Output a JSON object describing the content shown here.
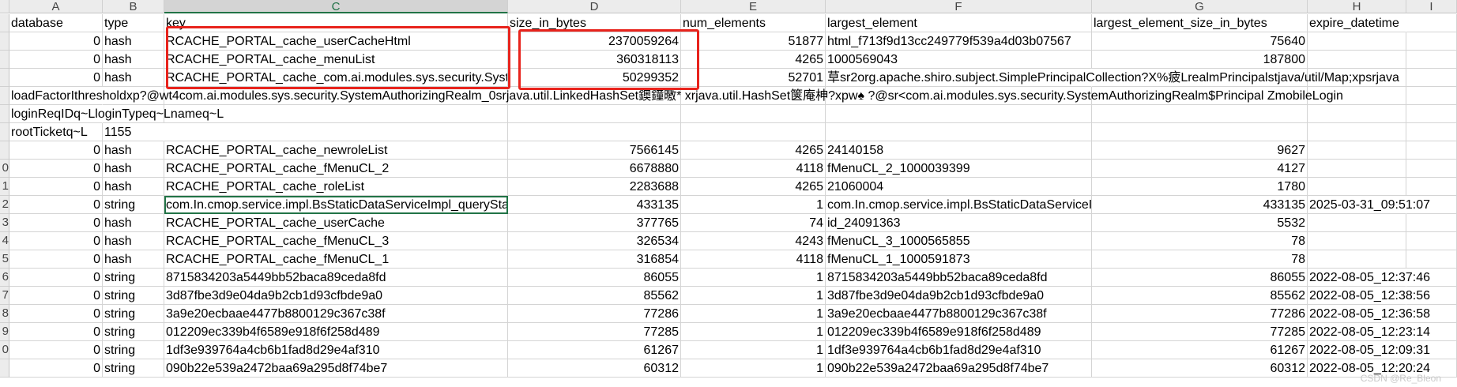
{
  "columns": [
    "A",
    "B",
    "C",
    "D",
    "E",
    "F",
    "G",
    "H",
    "I"
  ],
  "selected_column": "C",
  "row_numbers": [
    "",
    "",
    "",
    "",
    "",
    "",
    "",
    "",
    "0",
    "1",
    "2",
    "3",
    "4",
    "5",
    "6",
    "7",
    "8",
    "9",
    "0",
    ""
  ],
  "rows": [
    [
      "database",
      "type",
      "key",
      "size_in_bytes",
      "num_elements",
      "largest_element",
      "largest_element_size_in_bytes",
      "expire_datetime",
      ""
    ],
    [
      "0",
      "hash",
      "RCACHE_PORTAL_cache_userCacheHtml",
      "2370059264",
      "51877",
      "html_f713f9d13cc249779f539a4d03b07567",
      "75640",
      "",
      ""
    ],
    [
      "0",
      "hash",
      "RCACHE_PORTAL_cache_menuList",
      "360318113",
      "4265",
      "1000569043",
      "187800",
      "",
      ""
    ],
    [
      "0",
      "hash",
      "RCACHE_PORTAL_cache_com.ai.modules.sys.security.SystemAuthorizingRealm",
      "50299352",
      "52701",
      "草\u0001sr2org.apache.shiro.subject.SimplePrincipalCollection?X%疲\u0001\u0001L\u0001realmPrincipals\u0001t\u0001java/util/Map;xpsr\u0001java",
      "",
      "",
      ""
    ],
    [
      "loadFactorIthresholdxp?@\u0001w\u0001\u0001t4com.ai.modules.sys.security.SystemAuthorizingRealm_0sr\u0001java.util.LinkedHashSet鐭鐘曒* xr\u0001java.util.HashSet箧庵柛?\u0001xpw♠ ?@\u0001sr<com.ai.modules.sys.security.SystemAuthorizingRealm$Principal\u0001 \u0001Z\u0001mobileLogin",
      "",
      "",
      "",
      "",
      "",
      "",
      "",
      ""
    ],
    [
      "loginReqIDq~\u0001LloginTypeq~\u0001L\u0001nameq~\u0001L",
      "",
      "",
      "",
      "",
      "",
      "",
      "",
      ""
    ],
    [
      "rootTicketq~\u0001L\u0001",
      "1155",
      "",
      "",
      "",
      "",
      "",
      "",
      ""
    ],
    [
      "0",
      "hash",
      "RCACHE_PORTAL_cache_newroleList",
      "7566145",
      "4265",
      "24140158",
      "9627",
      "",
      ""
    ],
    [
      "0",
      "hash",
      "RCACHE_PORTAL_cache_fMenuCL_2",
      "6678880",
      "4118",
      "fMenuCL_2_1000039399",
      "4127",
      "",
      ""
    ],
    [
      "0",
      "hash",
      "RCACHE_PORTAL_cache_roleList",
      "2283688",
      "4265",
      "21060004",
      "1780",
      "",
      ""
    ],
    [
      "0",
      "string",
      "com.In.cmop.service.impl.BsStaticDataServiceImpl_queryStaticDataList",
      "433135",
      "1",
      "com.In.cmop.service.impl.BsStaticDataServiceImpl",
      "433135",
      "2025-03-31_09:51:07",
      ""
    ],
    [
      "0",
      "hash",
      "RCACHE_PORTAL_cache_userCache",
      "377765",
      "74",
      "id_24091363",
      "5532",
      "",
      ""
    ],
    [
      "0",
      "hash",
      "RCACHE_PORTAL_cache_fMenuCL_3",
      "326534",
      "4243",
      "fMenuCL_3_1000565855",
      "78",
      "",
      ""
    ],
    [
      "0",
      "hash",
      "RCACHE_PORTAL_cache_fMenuCL_1",
      "316854",
      "4118",
      "fMenuCL_1_1000591873",
      "78",
      "",
      ""
    ],
    [
      "0",
      "string",
      "8715834203a5449bb52baca89ceda8fd",
      "86055",
      "1",
      "8715834203a5449bb52baca89ceda8fd",
      "86055",
      "2022-08-05_12:37:46",
      ""
    ],
    [
      "0",
      "string",
      "3d87fbe3d9e04da9b2cb1d93cfbde9a0",
      "85562",
      "1",
      "3d87fbe3d9e04da9b2cb1d93cfbde9a0",
      "85562",
      "2022-08-05_12:38:56",
      ""
    ],
    [
      "0",
      "string",
      "3a9e20ecbaae4477b8800129c367c38f",
      "77286",
      "1",
      "3a9e20ecbaae4477b8800129c367c38f",
      "77286",
      "2022-08-05_12:36:58",
      ""
    ],
    [
      "0",
      "string",
      "012209ec339b4f6589e918f6f258d489",
      "77285",
      "1",
      "012209ec339b4f6589e918f6f258d489",
      "77285",
      "2022-08-05_12:23:14",
      ""
    ],
    [
      "0",
      "string",
      "1df3e939764a4cb6b1fad8d29e4af310",
      "61267",
      "1",
      "1df3e939764a4cb6b1fad8d29e4af310",
      "61267",
      "2022-08-05_12:09:31",
      ""
    ],
    [
      "0",
      "string",
      "090b22e539a2472baa69a295d8f74be7",
      "60312",
      "1",
      "090b22e539a2472baa69a295d8f74be7",
      "60312",
      "2022-08-05_12:20:24",
      ""
    ]
  ],
  "watermark": "CSDN @Re_Bleon"
}
